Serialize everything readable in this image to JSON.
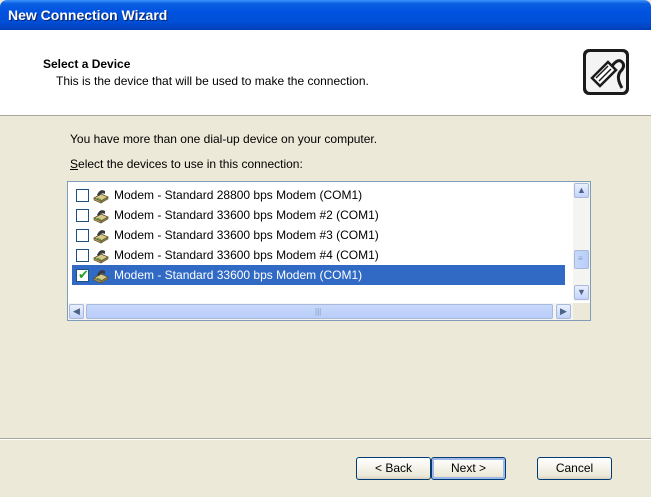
{
  "window": {
    "title": "New Connection Wizard"
  },
  "header": {
    "title": "Select a Device",
    "subtitle": "This is the device that will be used to make the connection."
  },
  "content": {
    "message": "You have more than one dial-up device on your computer.",
    "instruction": "Select the devices to use in this connection:"
  },
  "devices": [
    {
      "label": "Modem - Standard 28800 bps Modem (COM1)",
      "checked": false,
      "selected": false
    },
    {
      "label": "Modem - Standard 33600 bps Modem #2 (COM1)",
      "checked": false,
      "selected": false
    },
    {
      "label": "Modem - Standard 33600 bps Modem #3 (COM1)",
      "checked": false,
      "selected": false
    },
    {
      "label": "Modem - Standard 33600 bps Modem #4 (COM1)",
      "checked": false,
      "selected": false
    },
    {
      "label": "Modem - Standard 33600 bps Modem (COM1)",
      "checked": true,
      "selected": true
    }
  ],
  "buttons": {
    "back": "< Back",
    "next": "Next >",
    "cancel": "Cancel"
  },
  "colors": {
    "titlebar": "#0050d8",
    "selection": "#316ac5",
    "dialog": "#ece9d8"
  }
}
